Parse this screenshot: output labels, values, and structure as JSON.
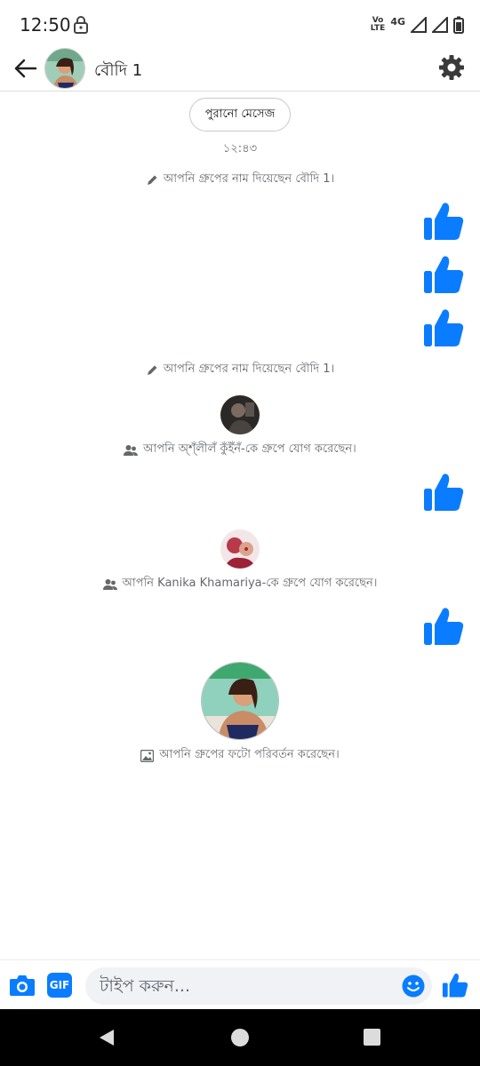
{
  "status_bar": {
    "time": "12:50",
    "volte": "Vo\nLTE",
    "network": "4G"
  },
  "header": {
    "title": "বৌদি 1"
  },
  "chat": {
    "old_messages_label": "পুরানো মেসেজ",
    "timestamp": "১২:৪৩",
    "events": [
      {
        "type": "system",
        "icon": "pencil-icon",
        "text": "আপনি গ্রুপের নাম দিয়েছেন বৌদি 1।"
      },
      {
        "type": "like"
      },
      {
        "type": "like"
      },
      {
        "type": "like"
      },
      {
        "type": "system",
        "icon": "pencil-icon",
        "text": "আপনি গ্রুপের নাম দিয়েছেন বৌদি 1।"
      },
      {
        "type": "system",
        "icon": "people-icon",
        "text": "আপনি অ্শ্ঁলীলঁ কুঁইঁনঁ-কে গ্রুপে যোগ করেছেন।"
      },
      {
        "type": "like"
      },
      {
        "type": "system",
        "icon": "people-icon",
        "text": "আপনি Kanika Khamariya-কে গ্রুপে যোগ করেছেন।"
      },
      {
        "type": "like"
      },
      {
        "type": "system",
        "icon": "photo-icon",
        "text": "আপনি গ্রুপের ফটো পরিবর্তন করেছেন।"
      }
    ]
  },
  "composer": {
    "gif_label": "GIF",
    "placeholder": "টাইপ করুন..."
  },
  "colors": {
    "accent": "#0a7cff",
    "system_text": "#65676b",
    "nav_bar": "#000000"
  }
}
